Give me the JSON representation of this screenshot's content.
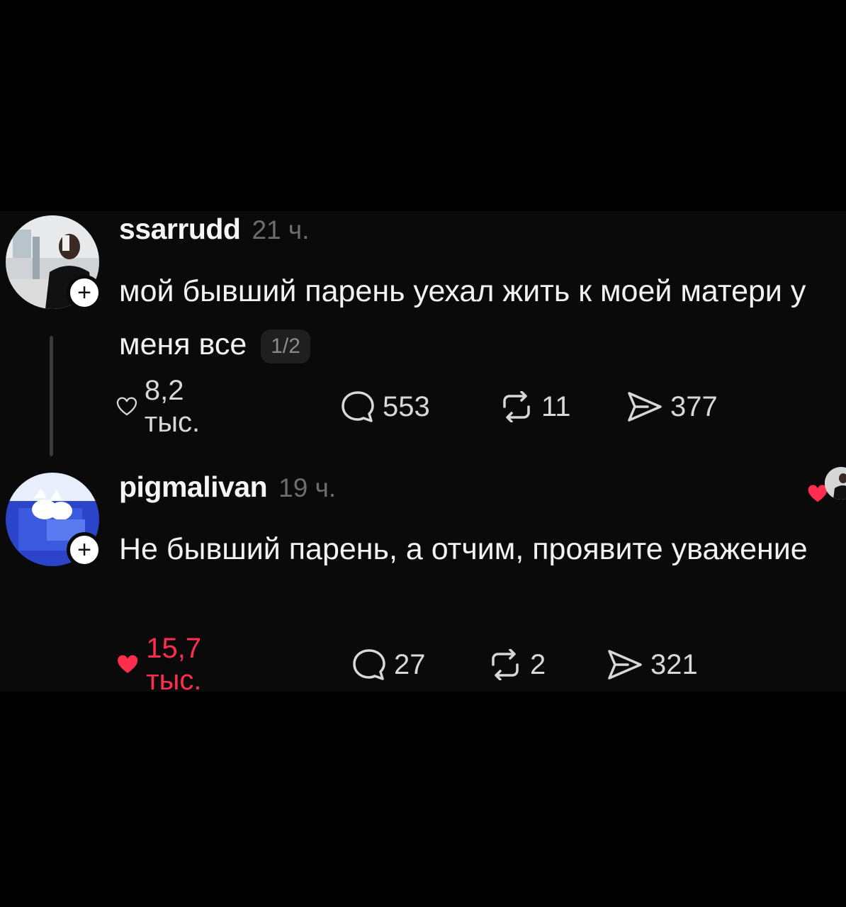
{
  "posts": [
    {
      "username": "ssarrudd",
      "time": "21 ч.",
      "text": "мой бывший парень уехал жить к моей матери у меня все",
      "pager": "1/2",
      "likes": "8,2 тыс.",
      "comments": "553",
      "reposts": "11",
      "shares": "377",
      "liked": false
    },
    {
      "username": "pigmalivan",
      "time": "19 ч.",
      "text": "Не бывший парень, а отчим, проявите уважение",
      "likes": "15,7 тыс.",
      "comments": "27",
      "reposts": "2",
      "shares": "321",
      "liked": true
    }
  ],
  "follow_symbol": "+",
  "colors": {
    "background": "#000000",
    "like": "#ff2d4e",
    "muted": "#6d6d6d"
  },
  "icons": [
    "heart-icon",
    "comment-icon",
    "repost-icon",
    "share-icon",
    "plus-icon"
  ]
}
